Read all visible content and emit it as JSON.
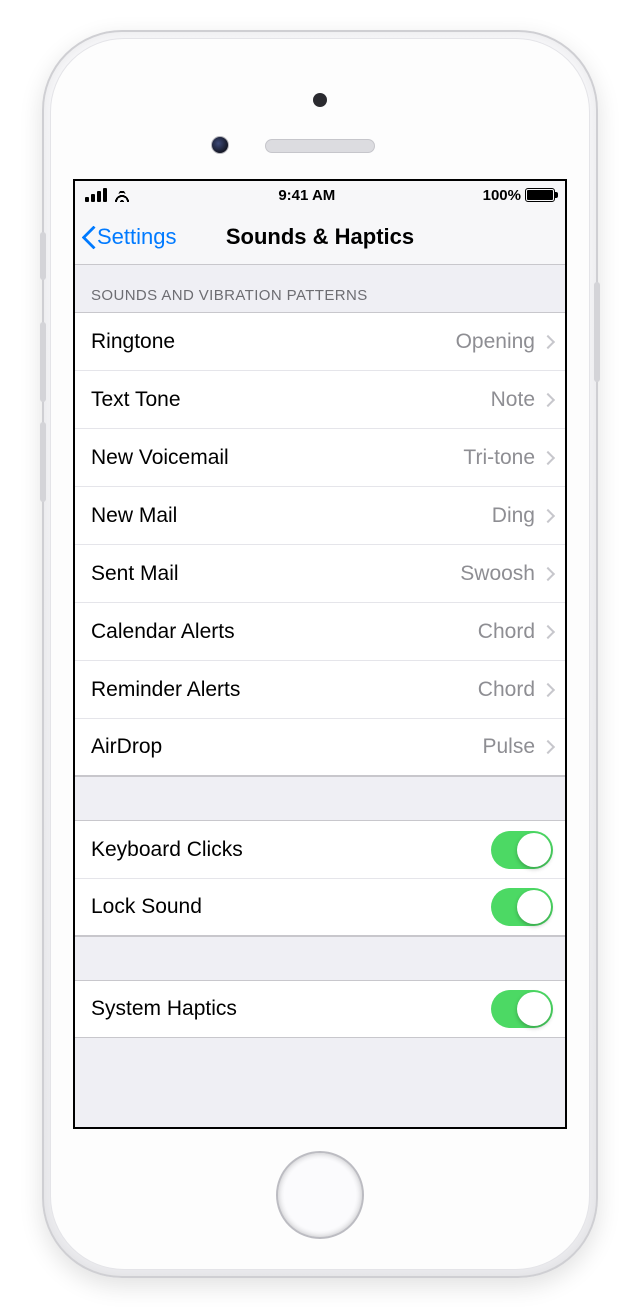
{
  "statusbar": {
    "time": "9:41 AM",
    "battery_text": "100%"
  },
  "navbar": {
    "back_label": "Settings",
    "title": "Sounds & Haptics"
  },
  "sections": {
    "patterns_header": "SOUNDS AND VIBRATION PATTERNS"
  },
  "sound_items": [
    {
      "label": "Ringtone",
      "value": "Opening"
    },
    {
      "label": "Text Tone",
      "value": "Note"
    },
    {
      "label": "New Voicemail",
      "value": "Tri-tone"
    },
    {
      "label": "New Mail",
      "value": "Ding"
    },
    {
      "label": "Sent Mail",
      "value": "Swoosh"
    },
    {
      "label": "Calendar Alerts",
      "value": "Chord"
    },
    {
      "label": "Reminder Alerts",
      "value": "Chord"
    },
    {
      "label": "AirDrop",
      "value": "Pulse"
    }
  ],
  "toggle_items_a": [
    {
      "label": "Keyboard Clicks",
      "on": true
    },
    {
      "label": "Lock Sound",
      "on": true
    }
  ],
  "toggle_items_b": [
    {
      "label": "System Haptics",
      "on": true
    }
  ]
}
